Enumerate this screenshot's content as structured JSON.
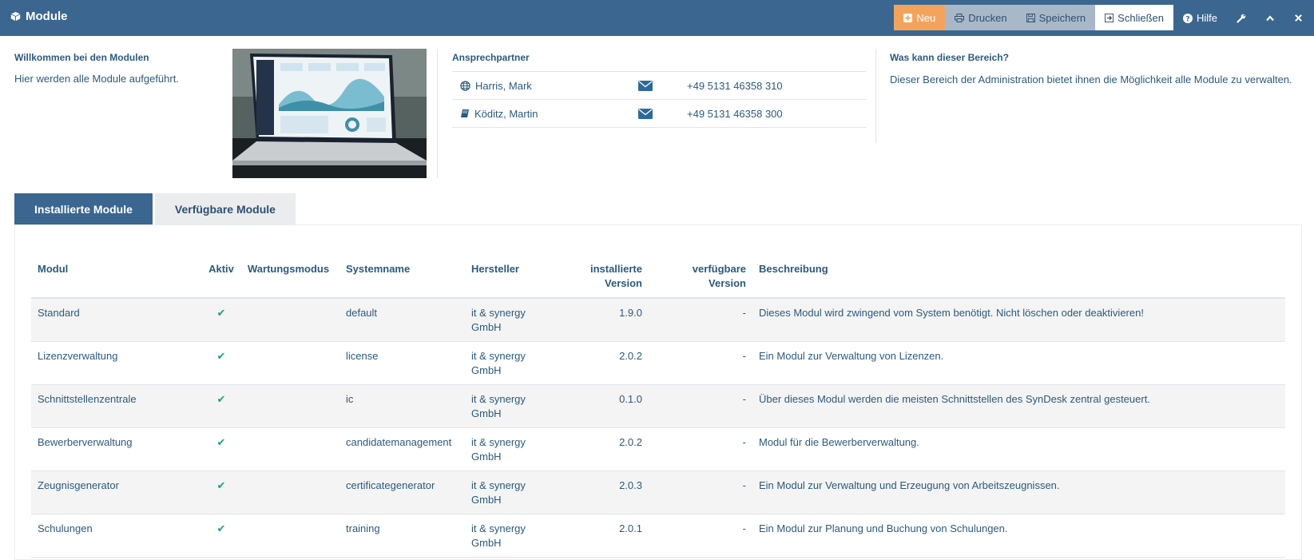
{
  "header": {
    "title": "Module",
    "toolbar": {
      "new": "Neu",
      "print": "Drucken",
      "save": "Speichern",
      "close": "Schließen",
      "help": "Hilfe"
    }
  },
  "welcome": {
    "heading": "Willkommen bei den Modulen",
    "text": "Hier werden alle Module aufgeführt."
  },
  "contacts": {
    "heading": "Ansprechpartner",
    "rows": [
      {
        "name": "Harris, Mark",
        "icon": "globe-icon",
        "phone": "+49 5131 46358 310"
      },
      {
        "name": "Köditz, Martin",
        "icon": "book-icon",
        "phone": "+49 5131 46358 300"
      }
    ]
  },
  "about": {
    "heading": "Was kann dieser Bereich?",
    "text": "Dieser Bereich der Administration bietet ihnen die Möglichkeit alle Module zu verwalten."
  },
  "tabs": [
    {
      "label": "Installierte Module",
      "active": true
    },
    {
      "label": "Verfügbare Module",
      "active": false
    }
  ],
  "table": {
    "headers": {
      "modul": "Modul",
      "aktiv": "Aktiv",
      "wartung": "Wartungsmodus",
      "systemname": "Systemname",
      "hersteller": "Hersteller",
      "inst_line1": "installierte",
      "inst_line2": "Version",
      "verf_line1": "verfügbare",
      "verf_line2": "Version",
      "beschreibung": "Beschreibung"
    },
    "rows": [
      {
        "modul": "Standard",
        "aktiv": "✔",
        "wartung": "",
        "systemname": "default",
        "hersteller_1": "it & synergy",
        "hersteller_2": "GmbH",
        "installiert": "1.9.0",
        "verfuegbar": "-",
        "beschreibung": "Dieses Modul wird zwingend vom System benötigt. Nicht löschen oder deaktivieren!"
      },
      {
        "modul": "Lizenzverwaltung",
        "aktiv": "✔",
        "wartung": "",
        "systemname": "license",
        "hersteller_1": "it & synergy",
        "hersteller_2": "GmbH",
        "installiert": "2.0.2",
        "verfuegbar": "-",
        "beschreibung": "Ein Modul zur Verwaltung von Lizenzen."
      },
      {
        "modul": "Schnittstellenzentrale",
        "aktiv": "✔",
        "wartung": "",
        "systemname": "ic",
        "hersteller_1": "it & synergy",
        "hersteller_2": "GmbH",
        "installiert": "0.1.0",
        "verfuegbar": "-",
        "beschreibung": "Über dieses Modul werden die meisten Schnittstellen des SynDesk zentral gesteuert."
      },
      {
        "modul": "Bewerberverwaltung",
        "aktiv": "✔",
        "wartung": "",
        "systemname": "candidatemanagement",
        "hersteller_1": "it & synergy",
        "hersteller_2": "GmbH",
        "installiert": "2.0.2",
        "verfuegbar": "-",
        "beschreibung": "Modul für die Bewerberverwaltung."
      },
      {
        "modul": "Zeugnisgenerator",
        "aktiv": "✔",
        "wartung": "",
        "systemname": "certificategenerator",
        "hersteller_1": "it & synergy",
        "hersteller_2": "GmbH",
        "installiert": "2.0.3",
        "verfuegbar": "-",
        "beschreibung": "Ein Modul zur Verwaltung und Erzeugung von Arbeitszeugnissen."
      },
      {
        "modul": "Schulungen",
        "aktiv": "✔",
        "wartung": "",
        "systemname": "training",
        "hersteller_1": "it & synergy",
        "hersteller_2": "GmbH",
        "installiert": "2.0.1",
        "verfuegbar": "-",
        "beschreibung": "Ein Modul zur Planung und Buchung von Schulungen."
      }
    ]
  },
  "colors": {
    "header_bg": "#3b6690",
    "accent_new": "#f4a35c",
    "check": "#1aa37f",
    "text": "#2b5a7e"
  }
}
